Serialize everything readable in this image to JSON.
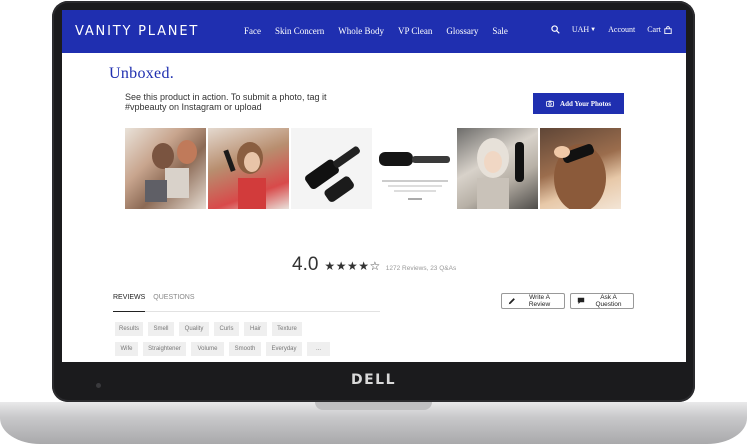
{
  "device": {
    "logo": "DELL"
  },
  "header": {
    "brand": "VANITY PLANET",
    "nav": [
      "Face",
      "Skin Concern",
      "Whole Body",
      "VP Clean",
      "Glossary",
      "Sale"
    ],
    "currency": "UAH",
    "account": "Account",
    "cart": "Cart",
    "brand_color": "#1f2fb0"
  },
  "unboxed": {
    "title": "Unboxed.",
    "intro": "See this product in action. To submit a photo, tag it #vpbeauty on Instagram or upload",
    "add_photos": "Add Your Photos"
  },
  "reviews": {
    "rating": "4.0",
    "stars_filled": 4,
    "stars_total": 5,
    "count_text": "1272 Reviews, 23 Q&As",
    "tabs": [
      "REVIEWS",
      "QUESTIONS"
    ],
    "write_review": "Write A Review",
    "ask_question": "Ask A Question",
    "filters": [
      "Results",
      "Smell",
      "Quality",
      "Curls",
      "Hair",
      "Texture",
      "Wife",
      "Straightener",
      "Volume",
      "Smooth",
      "Everyday",
      "..."
    ]
  }
}
